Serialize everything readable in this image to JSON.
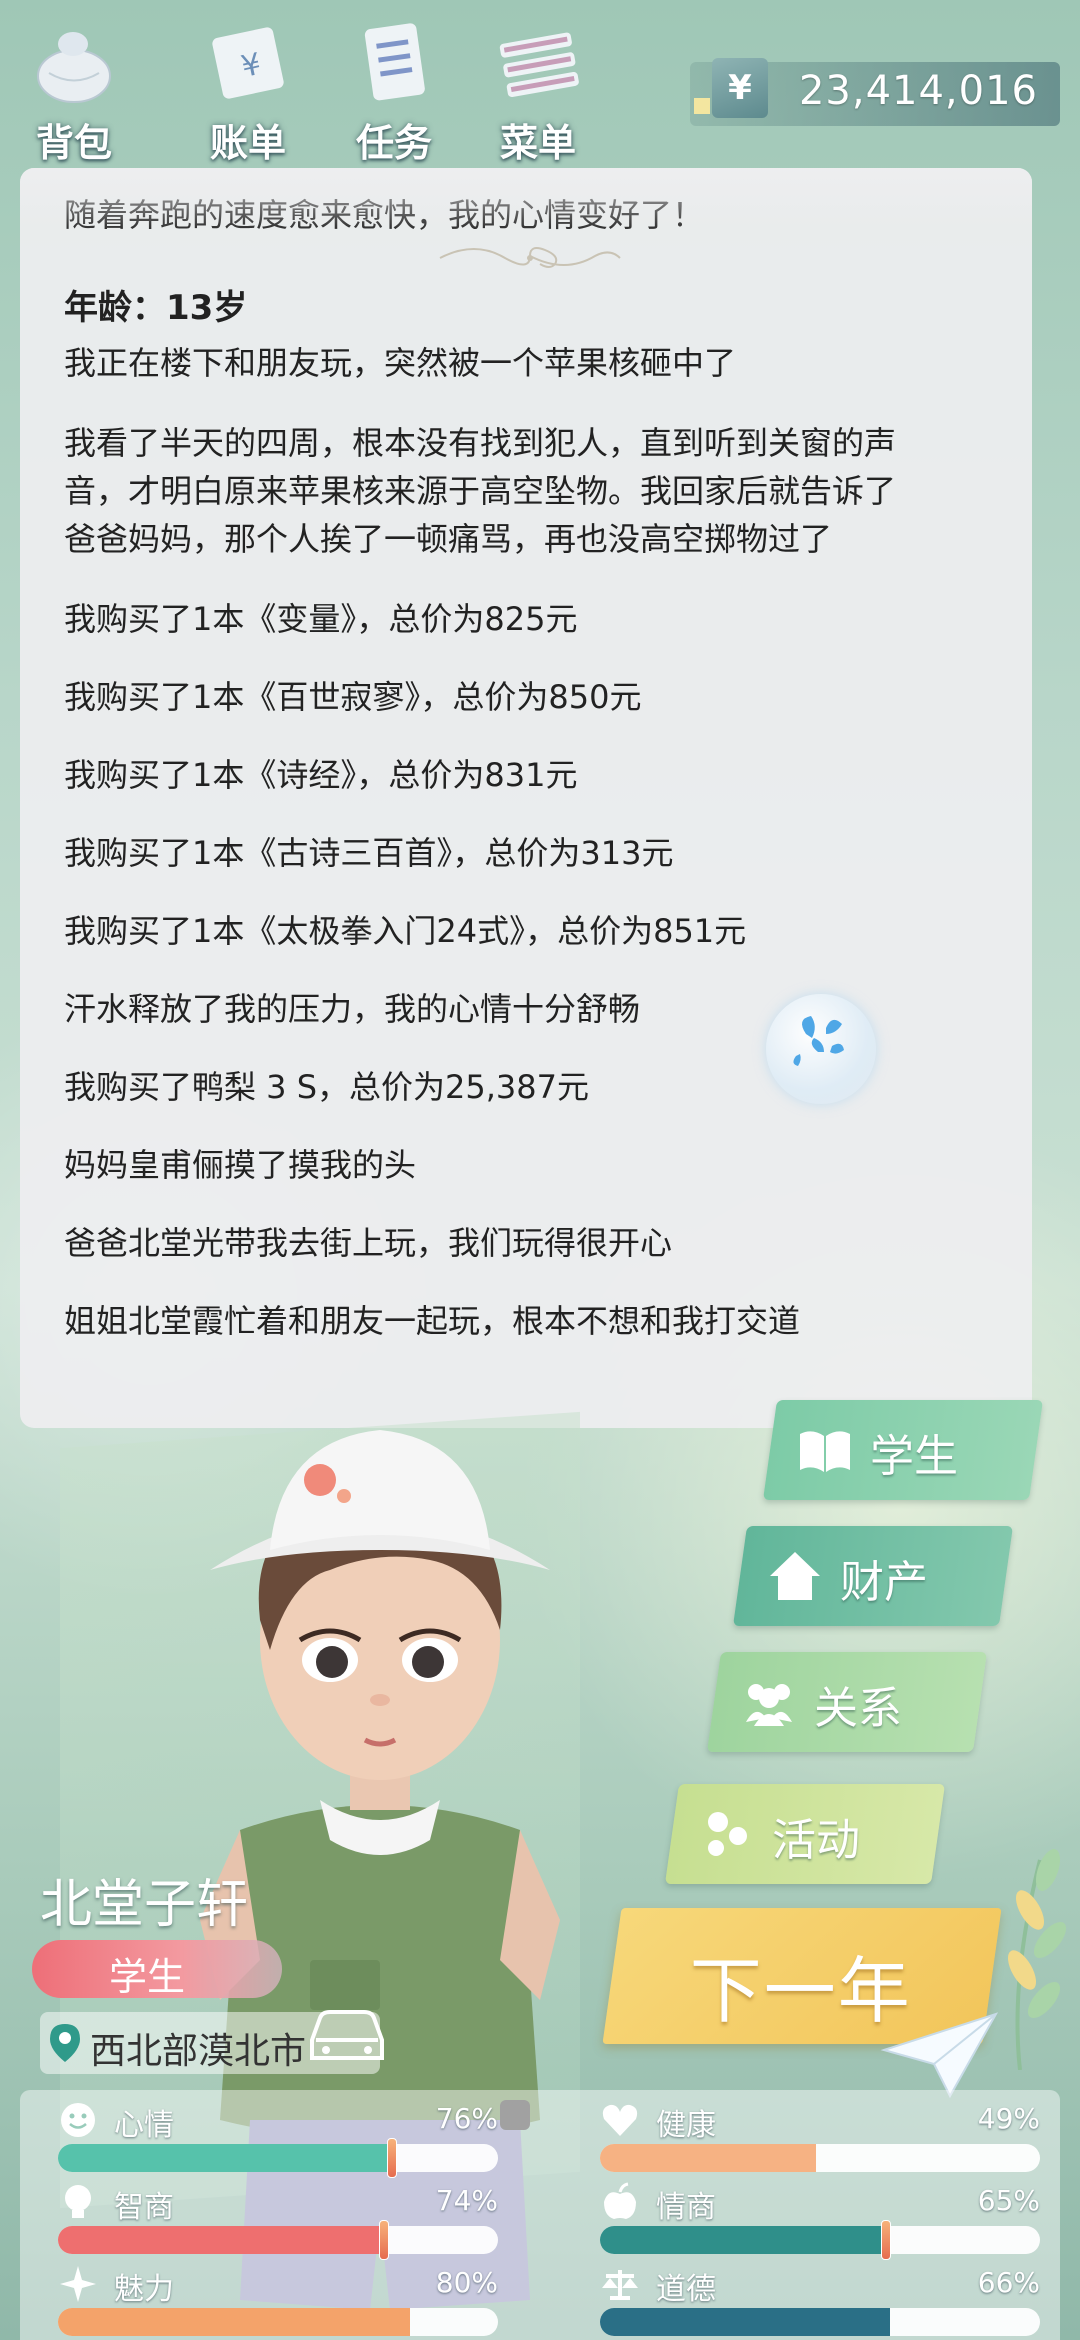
{
  "top_nav": [
    {
      "label": "背包",
      "icon": "bag-icon"
    },
    {
      "label": "账单",
      "icon": "bill-icon"
    },
    {
      "label": "任务",
      "icon": "task-icon"
    },
    {
      "label": "菜单",
      "icon": "menu-icon"
    }
  ],
  "money": {
    "symbol": "¥",
    "amount": "23,414,016"
  },
  "log": {
    "partial_top": "随着奔跑的速度愈来愈快，我的心情变好了！",
    "age_label": "年龄：13岁",
    "entries": [
      "我正在楼下和朋友玩，突然被一个苹果核砸中了",
      "我看了半天的四周，根本没有找到犯人，直到听到关窗的声",
      "音，才明白原来苹果核来源于高空坠物。我回家后就告诉了",
      "爸爸妈妈，那个人挨了一顿痛骂，再也没高空掷物过了",
      "我购买了1本《变量》，总价为825元",
      "我购买了1本《百世寂寥》，总价为850元",
      "我购买了1本《诗经》，总价为831元",
      "我购买了1本《古诗三百首》，总价为313元",
      "我购买了1本《太极拳入门24式》，总价为851元",
      "汗水释放了我的压力，我的心情十分舒畅",
      "我购买了鸭梨 3 S，总价为25,387元",
      "妈妈皇甫俪摸了摸我的头",
      "爸爸北堂光带我去街上玩，我们玩得很开心",
      "姐姐北堂霞忙着和朋友一起玩，根本不想和我打交道"
    ]
  },
  "side_menu": {
    "student": "学生",
    "assets": "财产",
    "relations": "关系",
    "activities": "活动"
  },
  "next_year": "下一年",
  "character": {
    "name": "北堂子轩",
    "job": "学生",
    "location": "西北部漠北市"
  },
  "stats": [
    {
      "label": "心情",
      "value": "76%",
      "level": 0.76,
      "color": "#56c2ab",
      "marker": true,
      "icon": "smile-icon"
    },
    {
      "label": "健康",
      "value": "49%",
      "level": 0.49,
      "color": "#f6b283",
      "marker": false,
      "icon": "heart-icon"
    },
    {
      "label": "智商",
      "value": "74%",
      "level": 0.74,
      "color": "#ee6f6f",
      "marker": true,
      "icon": "bulb-icon"
    },
    {
      "label": "情商",
      "value": "65%",
      "level": 0.65,
      "color": "#2f8f8a",
      "marker": true,
      "icon": "apple-icon"
    },
    {
      "label": "魅力",
      "value": "80%",
      "level": 0.8,
      "color": "#f4a36a",
      "marker": false,
      "icon": "sparkle-icon"
    },
    {
      "label": "道德",
      "value": "66%",
      "level": 0.66,
      "color": "#2a6f86",
      "marker": false,
      "icon": "scale-icon"
    }
  ]
}
